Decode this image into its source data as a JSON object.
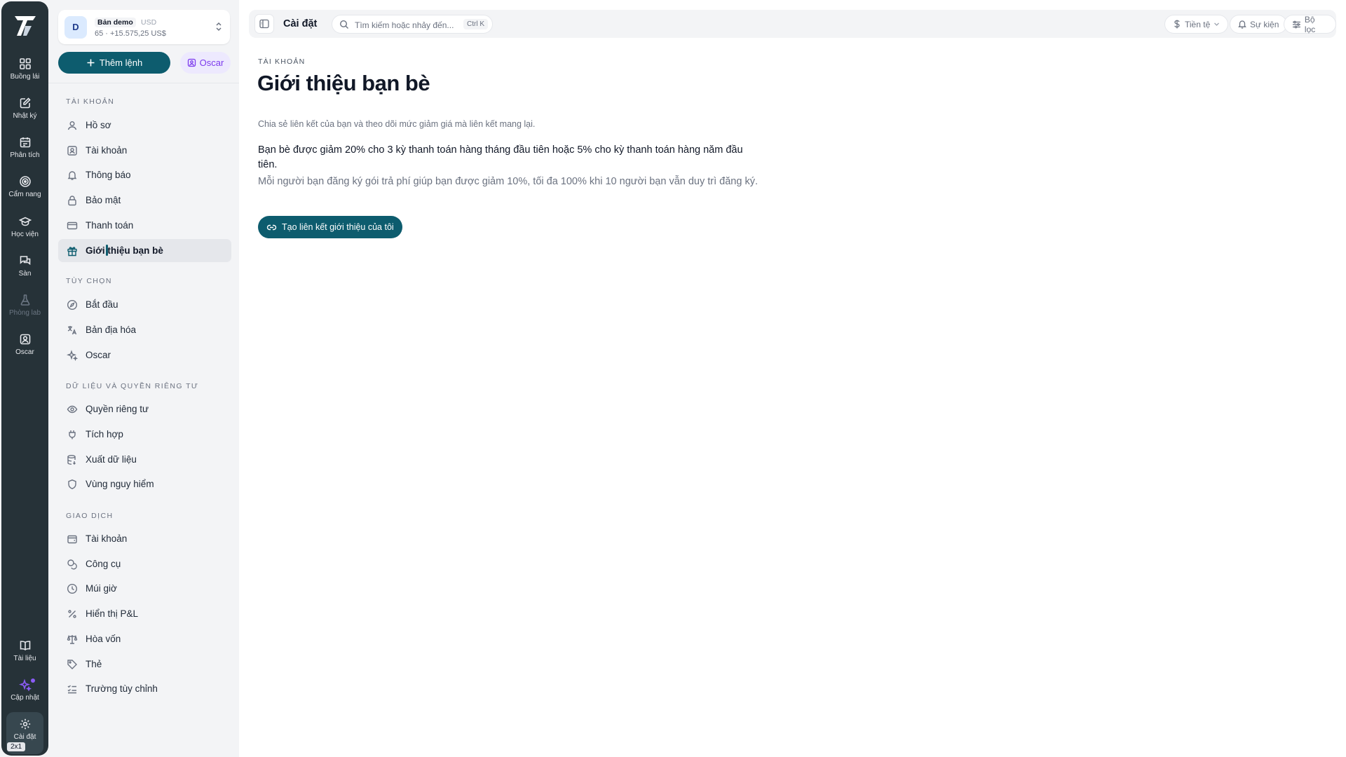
{
  "rail": {
    "items": [
      {
        "label": "Buồng lái",
        "icon": "dashboard-grid-icon"
      },
      {
        "label": "Nhật ký",
        "icon": "journal-edit-icon"
      },
      {
        "label": "Phân tích",
        "icon": "calendar-analytics-icon"
      },
      {
        "label": "Cẩm nang",
        "icon": "target-playbook-icon"
      },
      {
        "label": "Học viện",
        "icon": "graduation-cap-icon"
      },
      {
        "label": "Sàn",
        "icon": "chat-bubbles-icon"
      },
      {
        "label": "Phòng lab",
        "icon": "flask-icon"
      },
      {
        "label": "Oscar",
        "icon": "assistant-icon"
      },
      {
        "label": "Tài liệu",
        "icon": "book-icon"
      },
      {
        "label": "Cập nhật",
        "icon": "sparkle-icon"
      },
      {
        "label": "Cài đặt",
        "icon": "gear-icon"
      }
    ],
    "badge": "2x1",
    "update_dot_color": "#8b5cf6"
  },
  "account": {
    "avatar": "D",
    "name": "Bản demo",
    "currency": "USD",
    "balance": "65 · +15.575,25 US$"
  },
  "actions": {
    "add_order": "Thêm lệnh",
    "oscar": "Oscar"
  },
  "sections": [
    {
      "title": "Tài khoản",
      "items": [
        "Hồ sơ",
        "Tài khoản",
        "Thông báo",
        "Bảo mật",
        "Thanh toán",
        "Giới thiệu bạn bè"
      ]
    },
    {
      "title": "Tùy chọn",
      "items": [
        "Bắt đầu",
        "Bản địa hóa",
        "Oscar"
      ]
    },
    {
      "title": "Dữ liệu và quyền riêng tư",
      "items": [
        "Quyền riêng tư",
        "Tích hợp",
        "Xuất dữ liệu",
        "Vùng nguy hiểm"
      ]
    },
    {
      "title": "Giao dịch",
      "items": [
        "Tài khoản",
        "Công cụ",
        "Múi giờ",
        "Hiển thị P&L",
        "Hòa vốn",
        "Thẻ",
        "Trường tùy chỉnh"
      ]
    }
  ],
  "active_item": "Giới thiệu bạn bè",
  "topbar": {
    "title": "Cài đặt",
    "search_placeholder": "Tìm kiếm hoặc nhảy đến...",
    "search_shortcut": "Ctrl K",
    "currency": "Tiền tệ",
    "events": "Sự kiện",
    "filter": "Bộ lọc"
  },
  "page": {
    "eyebrow": "Tài khoản",
    "title": "Giới thiệu bạn bè",
    "subtitle": "Chia sẻ liên kết của bạn và theo dõi mức giảm giá mà liên kết mang lại.",
    "offer": "Bạn bè được giảm 20% cho 3 kỳ thanh toán hàng tháng đầu tiên hoặc 5% cho kỳ thanh toán hàng năm đầu tiên.",
    "reward": "Mỗi người bạn đăng ký gói trả phí giúp bạn được giảm 10%, tối đa 100% khi 10 người bạn vẫn duy trì đăng ký.",
    "cta": "Tạo liên kết giới thiệu của tôi"
  },
  "colors": {
    "rail": "#263238",
    "accent": "#0d5c6e",
    "oscar_bg": "#ede9fe",
    "oscar_text": "#7c3aed"
  }
}
